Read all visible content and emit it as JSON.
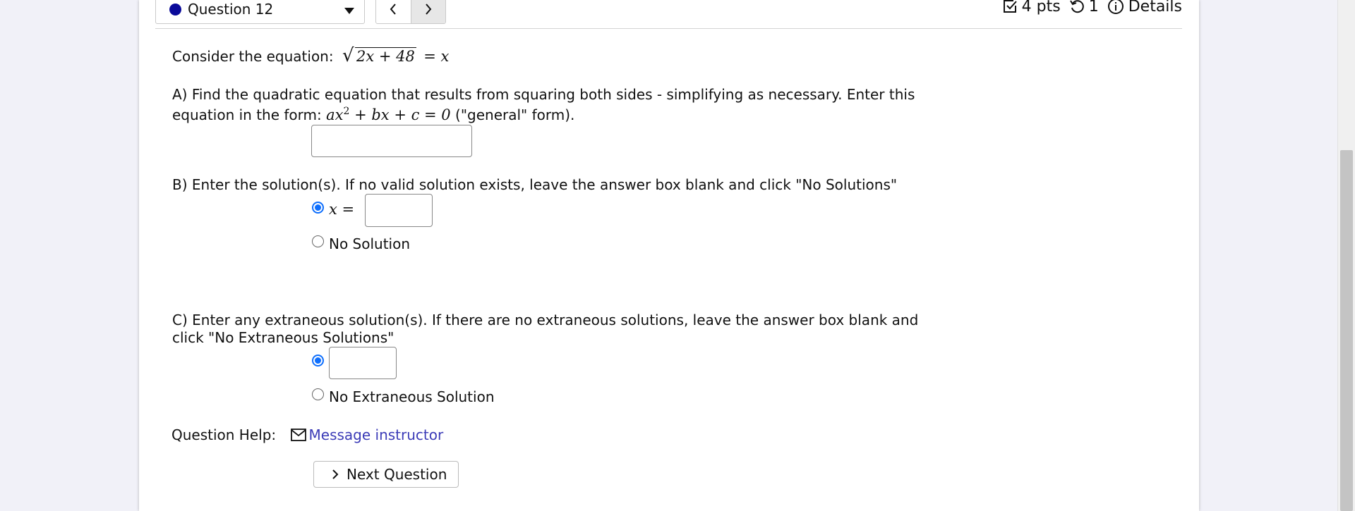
{
  "header": {
    "question_select": "Question 12",
    "points": "4 pts",
    "attempts": "1",
    "details": "Details"
  },
  "question": {
    "intro": "Consider the equation:",
    "equation_radicand": "2x + 48",
    "equation_rhs": "= x",
    "partA": {
      "line1": "A) Find the quadratic equation that results from squaring both sides - simplifying as necessary. Enter this",
      "line2_prefix": "equation in the form:",
      "form_math": "ax",
      "form_exp": "2",
      "form_rest": "+ bx + c = 0",
      "line2_suffix": "(\"general\" form).",
      "answer": ""
    },
    "partB": {
      "prompt": "B) Enter the solution(s). If no valid solution exists, leave the answer box blank and click \"No Solutions\"",
      "option1_label": "x =",
      "option1_value": "",
      "option2_label": "No Solution"
    },
    "partC": {
      "line1": "C) Enter any extraneous solution(s). If there are no extraneous solutions, leave the answer box blank and",
      "line2": "click \"No Extraneous Solutions\"",
      "option1_value": "",
      "option2_label": "No Extraneous Solution"
    }
  },
  "help": {
    "label": "Question Help:",
    "link": "Message instructor"
  },
  "next_button": "Next Question",
  "colors": {
    "accent": "#0d6efd",
    "link": "#3b3bb7",
    "question_dot": "#0a0a9a"
  }
}
